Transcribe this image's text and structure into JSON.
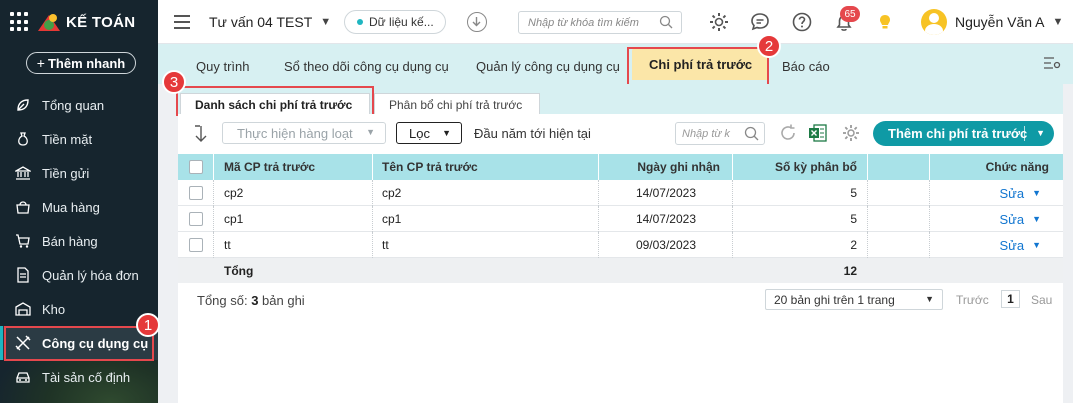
{
  "app": {
    "brand": "KẾ TOÁN",
    "quick_add": "Thêm nhanh"
  },
  "sidebar": {
    "items": [
      {
        "label": "Tổng quan",
        "icon": "leaf-icon"
      },
      {
        "label": "Tiền mặt",
        "icon": "money-bag-icon"
      },
      {
        "label": "Tiền gửi",
        "icon": "bank-icon"
      },
      {
        "label": "Mua hàng",
        "icon": "shopping-bag-icon"
      },
      {
        "label": "Bán hàng",
        "icon": "cart-icon"
      },
      {
        "label": "Quản lý hóa đơn",
        "icon": "invoice-icon"
      },
      {
        "label": "Kho",
        "icon": "warehouse-icon"
      },
      {
        "label": "Công cụ dụng cụ",
        "icon": "tools-icon",
        "active": true
      },
      {
        "label": "Tài sản cố định",
        "icon": "car-icon"
      }
    ]
  },
  "header": {
    "company": "Tư vấn 04 TEST",
    "data_pill": "Dữ liệu kế...",
    "search_placeholder": "Nhập từ khóa tìm kiếm",
    "notification_count": "65",
    "user_name": "Nguyễn Văn A"
  },
  "tabs": [
    {
      "label": "Quy trình"
    },
    {
      "label": "Sổ theo dõi công cụ dụng cụ"
    },
    {
      "label": "Quản lý công cụ dụng cụ"
    },
    {
      "label": "Chi phí trả trước",
      "active": true
    },
    {
      "label": "Báo cáo"
    }
  ],
  "subtabs": [
    {
      "label": "Danh sách chi phí trả trước",
      "active": true
    },
    {
      "label": "Phân bổ chi phí trả trước"
    }
  ],
  "toolbar": {
    "bulk_action": "Thực hiện hàng loạt",
    "filter": "Lọc",
    "period": "Đầu năm tới hiện tại",
    "search_placeholder": "Nhập từ k",
    "add_button": "Thêm chi phí trả trước"
  },
  "table": {
    "columns": [
      "Mã CP trả trước",
      "Tên CP trả trước",
      "Ngày ghi nhận",
      "Số kỳ phân bổ",
      "Chức năng"
    ],
    "rows": [
      {
        "code": "cp2",
        "name": "cp2",
        "date": "14/07/2023",
        "periods": "5",
        "action": "Sửa"
      },
      {
        "code": "cp1",
        "name": "cp1",
        "date": "14/07/2023",
        "periods": "5",
        "action": "Sửa"
      },
      {
        "code": "tt",
        "name": "tt",
        "date": "09/03/2023",
        "periods": "2",
        "action": "Sửa"
      }
    ],
    "total_label": "Tổng",
    "total_periods": "12"
  },
  "footer": {
    "total_prefix": "Tổng số: ",
    "total_count": "3",
    "total_suffix": " bản ghi",
    "page_size": "20 bản ghi trên 1 trang",
    "prev": "Trước",
    "page": "1",
    "next": "Sau"
  },
  "annotations": [
    "1",
    "2",
    "3"
  ],
  "colors": {
    "accent": "#0f9aa5",
    "sidebar": "#16252e",
    "tab_bg": "#d7f0f2",
    "active_tab": "#fbe6a8",
    "highlight": "#e5484d"
  }
}
